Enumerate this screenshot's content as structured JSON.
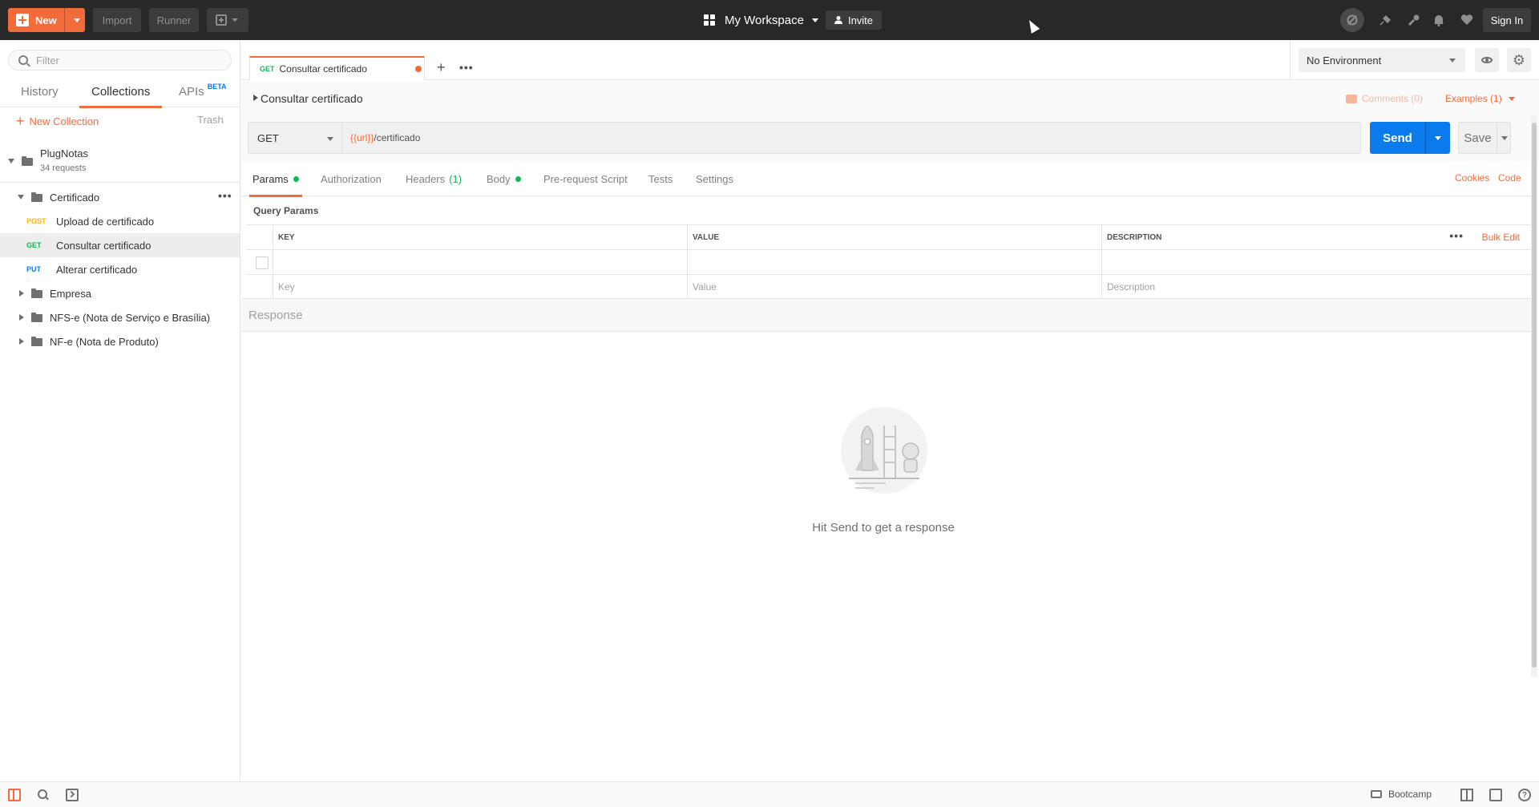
{
  "topbar": {
    "new_label": "New",
    "import_label": "Import",
    "runner_label": "Runner",
    "workspace_label": "My Workspace",
    "invite_label": "Invite",
    "signin_label": "Sign In"
  },
  "sidebar": {
    "filter_placeholder": "Filter",
    "tabs": [
      {
        "label": "History"
      },
      {
        "label": "Collections"
      },
      {
        "label": "APIs",
        "badge": "BETA"
      }
    ],
    "new_collection_label": "New Collection",
    "trash_label": "Trash",
    "collection": {
      "name": "PlugNotas",
      "count": "34 requests"
    },
    "tree": [
      {
        "type": "folder",
        "label": "Certificado",
        "expanded": true
      },
      {
        "type": "request",
        "method": "POST",
        "label": "Upload de certificado"
      },
      {
        "type": "request",
        "method": "GET",
        "label": "Consultar certificado",
        "selected": true
      },
      {
        "type": "request",
        "method": "PUT",
        "label": "Alterar certificado"
      },
      {
        "type": "folder",
        "label": "Empresa",
        "expanded": false
      },
      {
        "type": "folder",
        "label": "NFS-e (Nota de Serviço e Brasília)",
        "expanded": false
      },
      {
        "type": "folder",
        "label": "NF-e (Nota de Produto)",
        "expanded": false
      }
    ]
  },
  "tab": {
    "method": "GET",
    "title": "Consultar certificado"
  },
  "environment": {
    "selected": "No Environment"
  },
  "request": {
    "name": "Consultar certificado",
    "comments_label": "Comments (0)",
    "examples_label": "Examples (1)",
    "method": "GET",
    "url_var": "{{url}}",
    "url_path": "/certificado",
    "send_label": "Send",
    "save_label": "Save",
    "tabs": {
      "params": "Params",
      "authorization": "Authorization",
      "headers": "Headers",
      "headers_count": "(1)",
      "body": "Body",
      "prerequest": "Pre-request Script",
      "tests": "Tests",
      "settings": "Settings"
    },
    "cookies_label": "Cookies",
    "code_label": "Code"
  },
  "query_params": {
    "title": "Query Params",
    "headers": {
      "key": "KEY",
      "value": "VALUE",
      "description": "DESCRIPTION"
    },
    "bulk_edit_label": "Bulk Edit",
    "placeholders": {
      "key": "Key",
      "value": "Value",
      "description": "Description"
    }
  },
  "response": {
    "title": "Response",
    "empty_message": "Hit Send to get a response"
  },
  "bottombar": {
    "bootcamp_label": "Bootcamp"
  },
  "colors": {
    "brand": "#f26b3a",
    "send": "#097bed",
    "get": "#0cbb52",
    "post": "#ffb400",
    "put": "#097bed",
    "topbar": "#282828"
  },
  "icons": [
    "search-icon",
    "plus-icon",
    "caret-down-icon",
    "grid-icon",
    "person-add-icon",
    "sync-icon",
    "satellite-icon",
    "wrench-icon",
    "bell-icon",
    "heart-icon",
    "folder-icon",
    "eye-icon",
    "gear-icon",
    "comment-icon",
    "rocket-illustration",
    "sidebar-toggle-icon",
    "find-icon",
    "console-icon",
    "bootcamp-icon",
    "two-pane-icon",
    "browse-icon",
    "help-icon"
  ]
}
